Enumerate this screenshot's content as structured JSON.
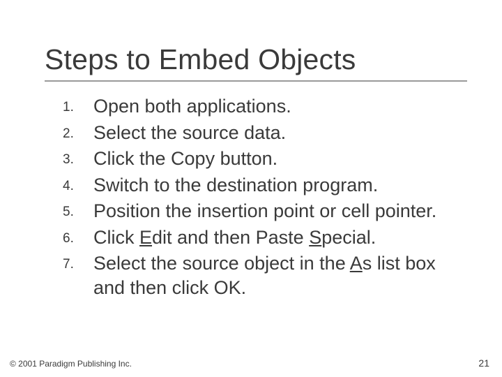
{
  "title": "Steps to Embed Objects",
  "steps": [
    {
      "html": "Open both applications."
    },
    {
      "html": "Select the source data."
    },
    {
      "html": "Click the Copy button."
    },
    {
      "html": "Switch to the destination program."
    },
    {
      "html": "Position the insertion point or cell pointer."
    },
    {
      "html": "Click <span class=\"ul\">E</span>dit and then Paste <span class=\"ul\">S</span>pecial."
    },
    {
      "html": "Select the source object in the <span class=\"ul\">A</span>s list box and then click OK."
    }
  ],
  "footer": {
    "copyright": "© 2001 Paradigm Publishing Inc.",
    "page": "21"
  }
}
